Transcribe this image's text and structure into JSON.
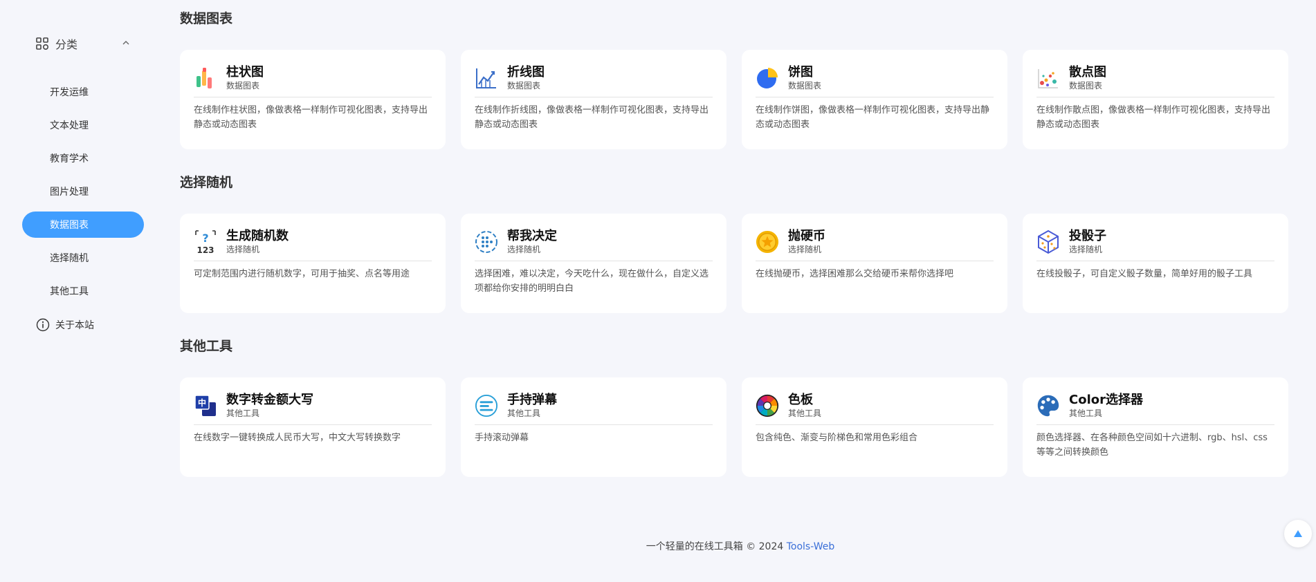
{
  "sidebar": {
    "category_label": "分类",
    "items": [
      {
        "label": "开发运维"
      },
      {
        "label": "文本处理"
      },
      {
        "label": "教育学术"
      },
      {
        "label": "图片处理"
      },
      {
        "label": "数据图表",
        "active": true
      },
      {
        "label": "选择随机"
      },
      {
        "label": "其他工具"
      }
    ],
    "about_label": "关于本站"
  },
  "sections": [
    {
      "title": "数据图表",
      "cards": [
        {
          "title": "柱状图",
          "category": "数据图表",
          "desc": "在线制作柱状图，像做表格一样制作可视化图表，支持导出静态或动态图表",
          "icon": "bar-chart-icon"
        },
        {
          "title": "折线图",
          "category": "数据图表",
          "desc": "在线制作折线图，像做表格一样制作可视化图表，支持导出静态或动态图表",
          "icon": "line-chart-icon"
        },
        {
          "title": "饼图",
          "category": "数据图表",
          "desc": "在线制作饼图，像做表格一样制作可视化图表，支持导出静态或动态图表",
          "icon": "pie-chart-icon"
        },
        {
          "title": "散点图",
          "category": "数据图表",
          "desc": "在线制作散点图，像做表格一样制作可视化图表，支持导出静态或动态图表",
          "icon": "scatter-chart-icon"
        }
      ]
    },
    {
      "title": "选择随机",
      "cards": [
        {
          "title": "生成随机数",
          "category": "选择随机",
          "desc": "可定制范围内进行随机数字，可用于抽奖、点名等用途",
          "icon": "random-number-icon"
        },
        {
          "title": "帮我决定",
          "category": "选择随机",
          "desc": "选择困难，难以决定，今天吃什么，现在做什么，自定义选项都给你安排的明明白白",
          "icon": "decide-wheel-icon"
        },
        {
          "title": "抛硬币",
          "category": "选择随机",
          "desc": "在线抛硬币，选择困难那么交给硬币来帮你选择吧",
          "icon": "coin-icon"
        },
        {
          "title": "投骰子",
          "category": "选择随机",
          "desc": "在线投骰子，可自定义骰子数量，简单好用的骰子工具",
          "icon": "dice-icon"
        }
      ]
    },
    {
      "title": "其他工具",
      "cards": [
        {
          "title": "数字转金额大写",
          "category": "其他工具",
          "desc": "在线数字一键转换成人民币大写，中文大写转换数字",
          "icon": "number-convert-icon"
        },
        {
          "title": "手持弹幕",
          "category": "其他工具",
          "desc": "手持滚动弹幕",
          "icon": "danmaku-icon"
        },
        {
          "title": "色板",
          "category": "其他工具",
          "desc": "包含纯色、渐变与阶梯色和常用色彩组合",
          "icon": "color-wheel-icon"
        },
        {
          "title": "Color选择器",
          "category": "其他工具",
          "desc": "颜色选择器、在各种颜色空间如十六进制、rgb、hsl、css等等之间转换颜色",
          "icon": "palette-icon"
        }
      ]
    }
  ],
  "footer": {
    "text": "一个轻量的在线工具箱 © 2024",
    "link": "Tools-Web"
  },
  "colors": {
    "accent": "#409eff",
    "background": "#f5f6fb",
    "link": "#3a6fd8"
  }
}
